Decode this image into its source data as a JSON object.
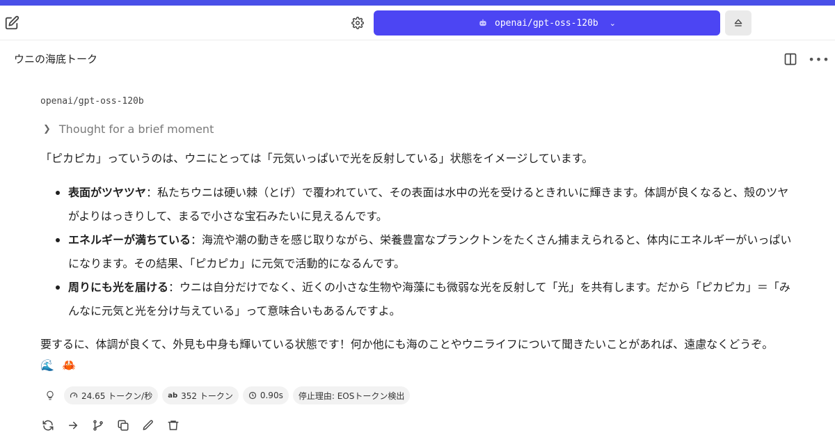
{
  "colors": {
    "stripe": "#4950e8",
    "model_button": "#4c45f3"
  },
  "header": {
    "model_name": "openai/gpt-oss-120b",
    "icons": [
      "edit-icon",
      "gear-icon",
      "robot-icon",
      "chevron-down-icon",
      "eject-icon"
    ]
  },
  "chat": {
    "title": "ウニの海底トーク",
    "icons": [
      "split-view-icon",
      "more-icon"
    ]
  },
  "message": {
    "model_label": "openai/gpt-oss-120b",
    "thought_label": "Thought for a brief moment",
    "intro": "「ピカピカ」っていうのは、ウニにとっては「元気いっぱいで光を反射している」状態をイメージしています。",
    "points": [
      {
        "title": "表面がツヤツヤ",
        "text": "：私たちウニは硬い棘（とげ）で覆われていて、その表面は水中の光を受けるときれいに輝きます。体調が良くなると、殻のツヤがよりはっきりして、まるで小さな宝石みたいに見えるんです。"
      },
      {
        "title": "エネルギーが満ちている",
        "text": "：海流や潮の動きを感じ取りながら、栄養豊富なプランクトンをたくさん捕まえられると、体内にエネルギーがいっぱいになります。その結果、「ピカピカ」に元気で活動的になるんです。"
      },
      {
        "title": "周りにも光を届ける",
        "text": "：ウニは自分だけでなく、近くの小さな生物や海藻にも微弱な光を反射して「光」を共有します。だから「ピカピカ」＝「みんなに元気と光を分け与えている」って意味合いもあるんですよ。"
      }
    ],
    "summary": "要するに、体調が良くて、外見も中身も輝いている状態です！何か他にも海のことやウニライフについて聞きたいことがあれば、遠慮なくどうぞ。",
    "emojis": [
      "🌊",
      "🦀"
    ]
  },
  "stats": {
    "speed": "24.65 トークン/秒",
    "tokens": "352 トークン",
    "time": "0.90s",
    "stop_reason": "停止理由: EOSトークン検出"
  },
  "actions": [
    "regenerate-icon",
    "continue-icon",
    "branch-icon",
    "copy-icon",
    "edit-icon",
    "delete-icon"
  ]
}
